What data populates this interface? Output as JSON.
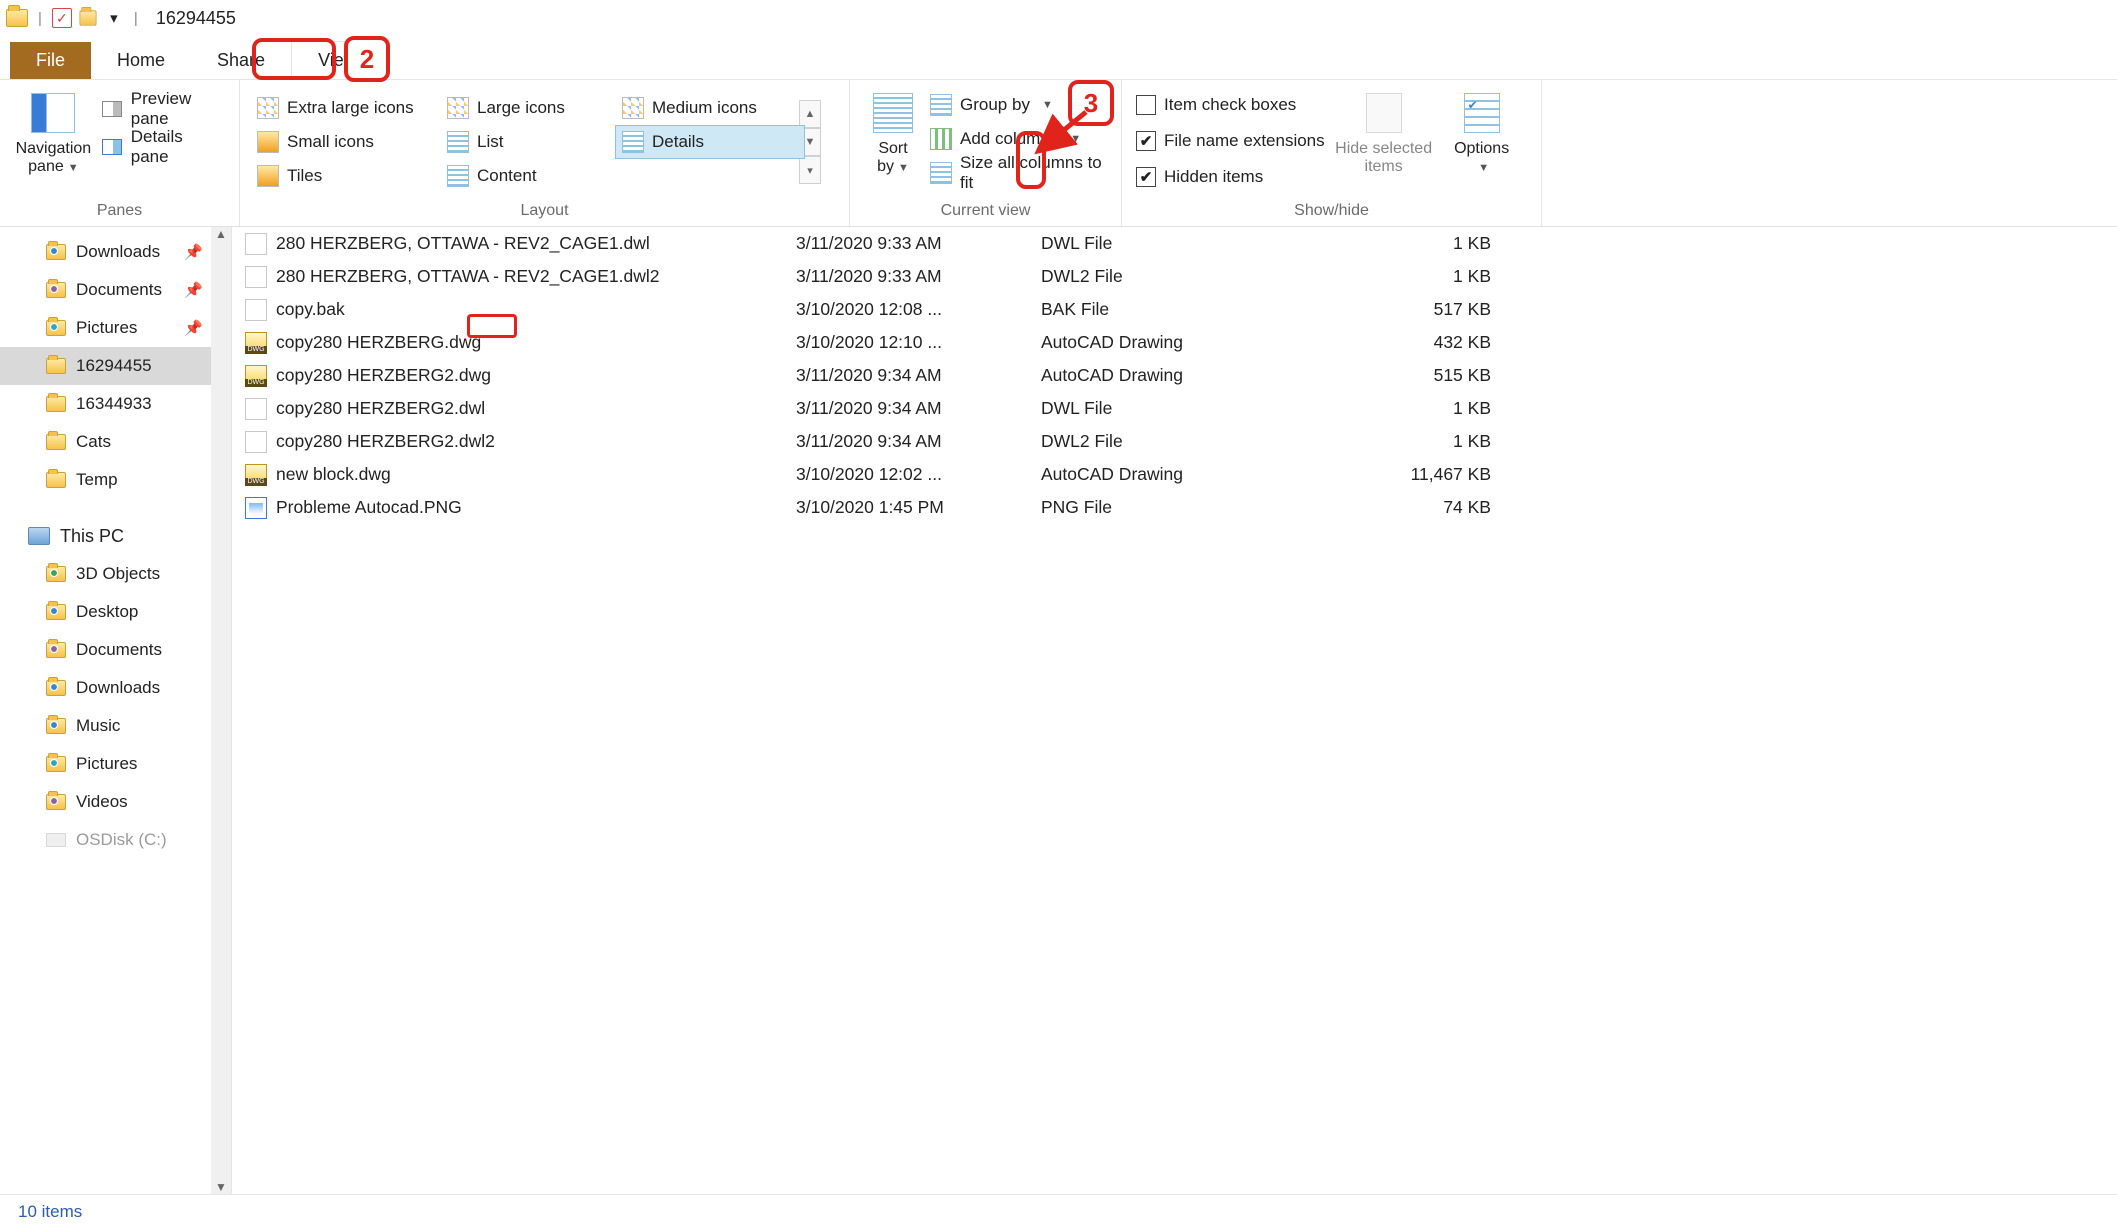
{
  "title": "16294455",
  "tabs": {
    "file": "File",
    "home": "Home",
    "share": "Share",
    "view": "View"
  },
  "panes": {
    "caption": "Panes",
    "navigation": "Navigation pane",
    "preview": "Preview pane",
    "details": "Details pane"
  },
  "layout": {
    "caption": "Layout",
    "xl": "Extra large icons",
    "large": "Large icons",
    "medium": "Medium icons",
    "small": "Small icons",
    "list": "List",
    "details": "Details",
    "tiles": "Tiles",
    "content": "Content"
  },
  "currentview": {
    "caption": "Current view",
    "sort": "Sort by",
    "group": "Group by",
    "addcols": "Add columns",
    "sizeall": "Size all columns to fit"
  },
  "showhide": {
    "caption": "Show/hide",
    "itemcheck": "Item check boxes",
    "ext": "File name extensions",
    "hidden": "Hidden items",
    "hidesel": "Hide selected items",
    "options": "Options"
  },
  "nav": {
    "downloads": "Downloads",
    "documents": "Documents",
    "pictures": "Pictures",
    "f1": "16294455",
    "f2": "16344933",
    "cats": "Cats",
    "temp": "Temp",
    "thispc": "This PC",
    "obj3d": "3D Objects",
    "desktop": "Desktop",
    "docs2": "Documents",
    "down2": "Downloads",
    "music": "Music",
    "pics2": "Pictures",
    "videos": "Videos",
    "osdisk": "OSDisk (C:)"
  },
  "files": [
    {
      "name": "280 HERZBERG, OTTAWA - REV2_CAGE1.dwl",
      "date": "3/11/2020 9:33 AM",
      "type": "DWL File",
      "size": "1 KB",
      "icon": "plain"
    },
    {
      "name": "280 HERZBERG, OTTAWA - REV2_CAGE1.dwl2",
      "date": "3/11/2020 9:33 AM",
      "type": "DWL2 File",
      "size": "1 KB",
      "icon": "plain"
    },
    {
      "name": "copy.bak",
      "date": "3/10/2020 12:08 ...",
      "type": "BAK File",
      "size": "517 KB",
      "icon": "plain"
    },
    {
      "name": "copy280 HERZBERG.dwg",
      "date": "3/10/2020 12:10 ...",
      "type": "AutoCAD Drawing",
      "size": "432 KB",
      "icon": "dwg"
    },
    {
      "name": "copy280 HERZBERG2.dwg",
      "date": "3/11/2020 9:34 AM",
      "type": "AutoCAD Drawing",
      "size": "515 KB",
      "icon": "dwg"
    },
    {
      "name": "copy280 HERZBERG2.dwl",
      "date": "3/11/2020 9:34 AM",
      "type": "DWL File",
      "size": "1 KB",
      "icon": "plain"
    },
    {
      "name": "copy280 HERZBERG2.dwl2",
      "date": "3/11/2020 9:34 AM",
      "type": "DWL2 File",
      "size": "1 KB",
      "icon": "plain"
    },
    {
      "name": "new block.dwg",
      "date": "3/10/2020 12:02 ...",
      "type": "AutoCAD Drawing",
      "size": "11,467 KB",
      "icon": "dwg"
    },
    {
      "name": "Probleme Autocad.PNG",
      "date": "3/10/2020 1:45 PM",
      "type": "PNG File",
      "size": "74 KB",
      "icon": "img"
    }
  ],
  "status": "10 items",
  "annotations": {
    "n2": "2",
    "n3": "3"
  }
}
